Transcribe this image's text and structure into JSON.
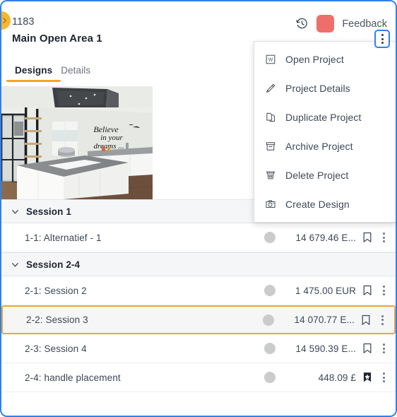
{
  "panel": {
    "accent_blue": "#2f80ed",
    "accent_orange": "#f5a623",
    "selected_border": "#f0a63c"
  },
  "header": {
    "project_id": "1183",
    "project_title": "Main Open Area 1",
    "history_icon": "history-clock-icon",
    "avatar_color": "#ee6f6a",
    "feedback_label": "Feedback",
    "kebab_icon": "more-vertical-icon"
  },
  "collapse_handle": {
    "icon": "chevron-right-icon",
    "color": "#f5b731"
  },
  "tabs": [
    {
      "label": "Designs",
      "active": true
    },
    {
      "label": "Details",
      "active": false
    }
  ],
  "thumbnail": {
    "alt": "3d-kitchen-render",
    "wall_text_line1": "Believe",
    "wall_text_line2": "in your",
    "wall_text_line3": "dreams ..."
  },
  "context_menu": {
    "items": [
      {
        "label": "Open Project",
        "icon": "word-document-icon"
      },
      {
        "label": "Project Details",
        "icon": "pencil-icon"
      },
      {
        "label": "Duplicate Project",
        "icon": "copy-pages-icon"
      },
      {
        "label": "Archive Project",
        "icon": "archive-box-icon"
      },
      {
        "label": "Delete Project",
        "icon": "trash-can-icon"
      },
      {
        "label": "Create Design",
        "icon": "camera-icon"
      }
    ]
  },
  "designs": {
    "groups": [
      {
        "label": "Session 1",
        "chevron": "chevron-down-icon",
        "rows": [
          {
            "name": "1-1: Alternatief - 1",
            "price": "14 679.46 E...",
            "status": "gray",
            "bookmarked": false,
            "bookmark_icon": "bookmark-outline-icon",
            "kebab_icon": "more-vertical-icon",
            "selected": false
          }
        ]
      },
      {
        "label": "Session 2-4",
        "chevron": "chevron-down-icon",
        "rows": [
          {
            "name": "2-1: Session 2",
            "price": "1 475.00 EUR",
            "status": "gray",
            "bookmarked": false,
            "bookmark_icon": "bookmark-outline-icon",
            "kebab_icon": "more-vertical-icon",
            "selected": false
          },
          {
            "name": "2-2: Session 3",
            "price": "14 070.77 E...",
            "status": "gray",
            "bookmarked": false,
            "bookmark_icon": "bookmark-outline-icon",
            "kebab_icon": "more-vertical-icon",
            "selected": true
          },
          {
            "name": "2-3: Session 4",
            "price": "14 590.39 E...",
            "status": "gray",
            "bookmarked": false,
            "bookmark_icon": "bookmark-outline-icon",
            "kebab_icon": "more-vertical-icon",
            "selected": false
          },
          {
            "name": "2-4: handle placement",
            "price": "448.09 £",
            "status": "gray",
            "bookmarked": true,
            "bookmark_icon": "bookmark-filled-star-icon",
            "kebab_icon": "more-vertical-icon",
            "selected": false
          }
        ]
      }
    ]
  }
}
